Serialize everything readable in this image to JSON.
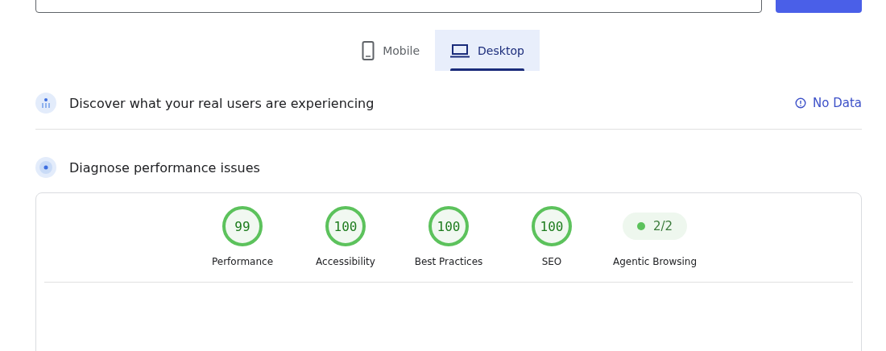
{
  "tabs": [
    {
      "label": "Mobile",
      "kind": "phone",
      "selected": false
    },
    {
      "label": "Desktop",
      "kind": "laptop",
      "selected": true
    }
  ],
  "field_data": {
    "title": "Discover what your real users are experiencing",
    "status": "No Data"
  },
  "diagnostics": {
    "title": "Diagnose performance issues",
    "scores": [
      {
        "kind": "gauge",
        "score": "99",
        "label": "Performance"
      },
      {
        "kind": "gauge",
        "score": "100",
        "label": "Accessibility"
      },
      {
        "kind": "gauge",
        "score": "100",
        "label": "Best Practices"
      },
      {
        "kind": "gauge",
        "score": "100",
        "label": "SEO"
      },
      {
        "kind": "pill",
        "score": "2/2",
        "label": "Agentic Browsing"
      }
    ]
  }
}
